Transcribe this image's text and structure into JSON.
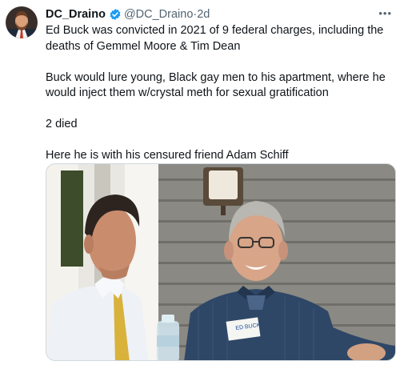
{
  "tweet": {
    "author": {
      "display_name": "DC_Draino",
      "handle": "@DC_Draino",
      "separator": "·",
      "time": "2d",
      "verified": true
    },
    "paragraphs": [
      "Ed Buck was convicted in 2021 of 9 federal charges, including the deaths of Gemmel Moore & Tim Dean",
      "Buck would lure young, Black gay men to his apartment, where he would inject them w/crystal meth for sexual gratification",
      "2 died",
      "Here he is with his censured friend Adam Schiff"
    ],
    "photo": {
      "name_tag_text": "ED BUCK"
    }
  },
  "icons": {
    "avatar": "profile-photo",
    "verified": "verified-badge-icon",
    "more": "more-options-icon"
  },
  "colors": {
    "verified_badge": "#1d9bf0",
    "secondary_text": "#536471",
    "primary_text": "#0f1419"
  }
}
